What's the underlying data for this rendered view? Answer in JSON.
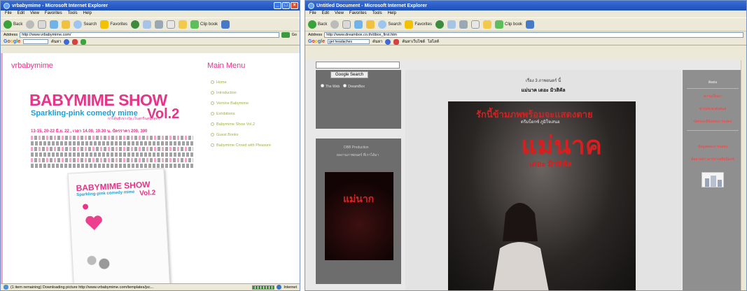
{
  "window1": {
    "title": "vrbabymime - Microsoft Internet Explorer",
    "menu": [
      "File",
      "Edit",
      "View",
      "Favorites",
      "Tools",
      "Help"
    ],
    "toolbar": {
      "back": "Back",
      "search": "Search",
      "favorites": "Favorites",
      "clipbook": "Clip book"
    },
    "address_label": "Address",
    "address": "http://www.vrbabymime.com/",
    "go": "Go",
    "links": "Links",
    "google_label": "Google",
    "google_query": "",
    "google_search_btn": "ค้นหา",
    "brand": "vrbabymime",
    "menu_header": "Main Menu",
    "menu_items": [
      "Home",
      "Introduction",
      "Vernine Babymime",
      "Exhibitions",
      "Babymime Show Vol.2",
      "Guest Books",
      "Babymime Crowd with Pleasure"
    ],
    "poster": {
      "title": "BABYMIME SHOW",
      "subtitle": "Sparkling-pink comedy mime",
      "vol": "Vol.2",
      "thai_tag": "การลุ้นชิงรางวัล เว็บสกรีนสนุกสุดๆ",
      "date_line": "13-15, 20-22 มิ.ย. 22 , เวลา 14.00, 19.30 น. บัตรราคา 200, 300",
      "cover_title": "BABYMIME SHOW",
      "cover_subtitle": "Sparkling-pink comedy mime",
      "cover_vol": "Vol.2"
    },
    "status": "(1 item remaining) Downloading picture http://www.vrbabymime.com/templates/jsc...",
    "zone": "Internet"
  },
  "window2": {
    "title": "Untitled Document - Microsoft Internet Explorer",
    "menu": [
      "File",
      "Edit",
      "View",
      "Favorites",
      "Tools",
      "Help"
    ],
    "toolbar": {
      "back": "Back",
      "search": "Search",
      "favorites": "Favorites",
      "clipbook": "Clip book"
    },
    "address_label": "Address",
    "address": "http://www.dreambox.co.th/dbox_first.htm",
    "google_label": "Google",
    "google_query": "get headaches",
    "google_search_btn": "ค้นหา",
    "google_extra": [
      "ค้นหาเว็บไซต์",
      "ไฮไลท์"
    ],
    "search_button": "Google Search",
    "radio_web": "The Web",
    "radio_site": "DreamBox",
    "left_heading": "DBB Production",
    "left_subheading": "ผลงานภาพยนตร์ ที่เราได้มา",
    "small_poster_title": "แม่นาก",
    "caption_top": "เรื่อง 3 ภาพยนตร์ นี้",
    "caption_main": "แม่นาค เดอะ มิวสิคัล",
    "main_poster": {
      "tagline": "รักนี้ข้ามภพพร้อมจะแสดงตาย",
      "subline": "ดรีมบ็อกซ์ ภูมิใจเสนอ",
      "big_title": "แม่นาค",
      "sub_title": "เดอะ มิวสิคัล"
    },
    "right_header": "ติดต่อ",
    "right_links": [
      "ความเป็นมา",
      "ข่าวประชาสัมพันธ์",
      "บัตรและที่นั่งรอบการแสดง",
      "ข้อมูลคณะการแสดง",
      "ติดตามข่าวสารจากดรีมบ็อกซ์"
    ]
  }
}
